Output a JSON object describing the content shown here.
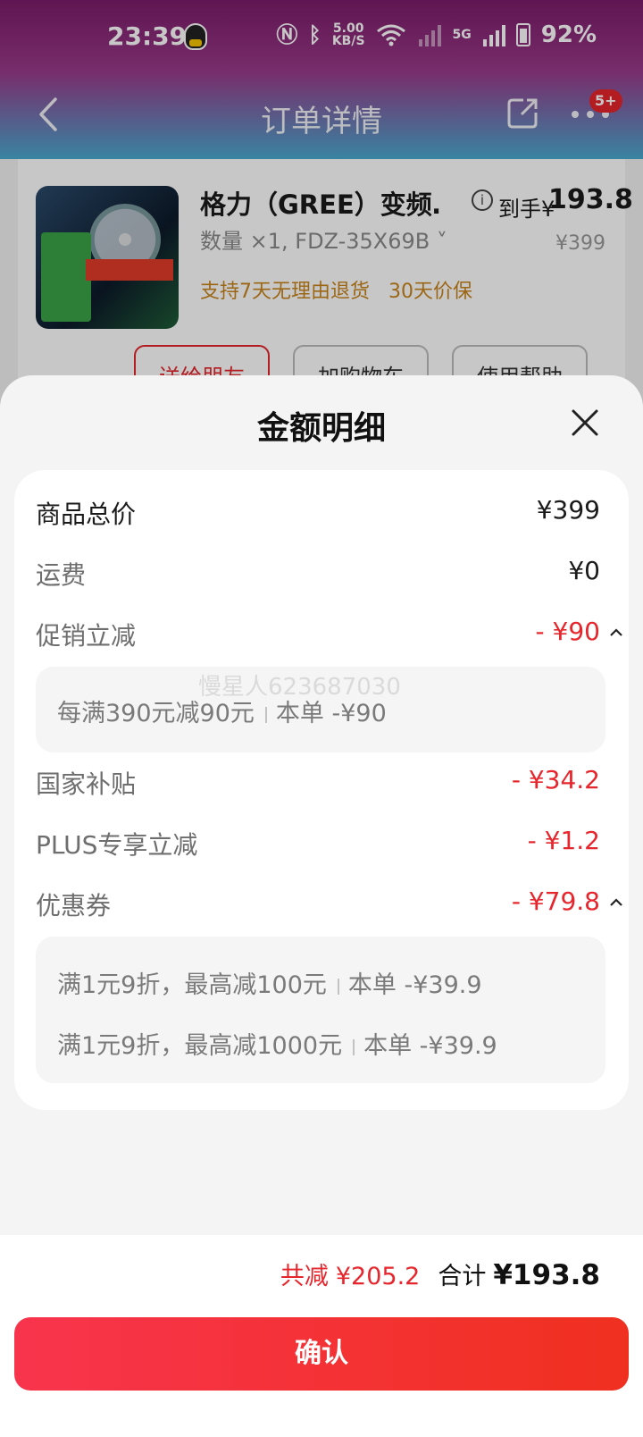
{
  "status_bar": {
    "time": "23:39",
    "net_speed_top": "5.00",
    "net_speed_unit": "KB/S",
    "signal_label": "5G",
    "battery": "92%"
  },
  "nav": {
    "title": "订单详情",
    "badge": "5+"
  },
  "order": {
    "product_title": "格力（GREE）变频…",
    "price_label": "到手¥",
    "price_value": "193.8",
    "spec": "数量 ×1, FDZ-35X69B ˅",
    "original_price": "¥399",
    "tags": [
      "支持7天无理由退货",
      "30天价保"
    ],
    "actions": [
      "送给朋友",
      "加购物车",
      "使用帮助"
    ]
  },
  "sheet": {
    "title": "金额明细",
    "rows": {
      "subtotal": {
        "label": "商品总价",
        "value": "¥399"
      },
      "shipping": {
        "label": "运费",
        "value": "¥0"
      },
      "promo": {
        "label": "促销立减",
        "value": "- ¥90"
      },
      "promo_detail": [
        {
          "rule": "每满390元减90元",
          "amount": "本单 -¥90"
        }
      ],
      "subsidy": {
        "label": "国家补贴",
        "value": "- ¥34.2"
      },
      "plus": {
        "label": "PLUS专享立减",
        "value": "- ¥1.2"
      },
      "coupon": {
        "label": "优惠券",
        "value": "- ¥79.8"
      },
      "coupon_detail": [
        {
          "rule": "满1元9折，最高减100元",
          "amount": "本单 -¥39.9"
        },
        {
          "rule": "满1元9折，最高减1000元",
          "amount": "本单 -¥39.9"
        }
      ]
    },
    "watermark": "慢星人623687030"
  },
  "footer": {
    "saving_label": "共减",
    "saving_value": "¥205.2",
    "total_label": "合计",
    "total_value": "¥193.8",
    "confirm_label": "确认"
  },
  "colors": {
    "accent_red": "#e6262c",
    "header_top": "#7a1c68",
    "header_bottom": "#4aa9cf",
    "tag_orange": "#c8841c"
  }
}
